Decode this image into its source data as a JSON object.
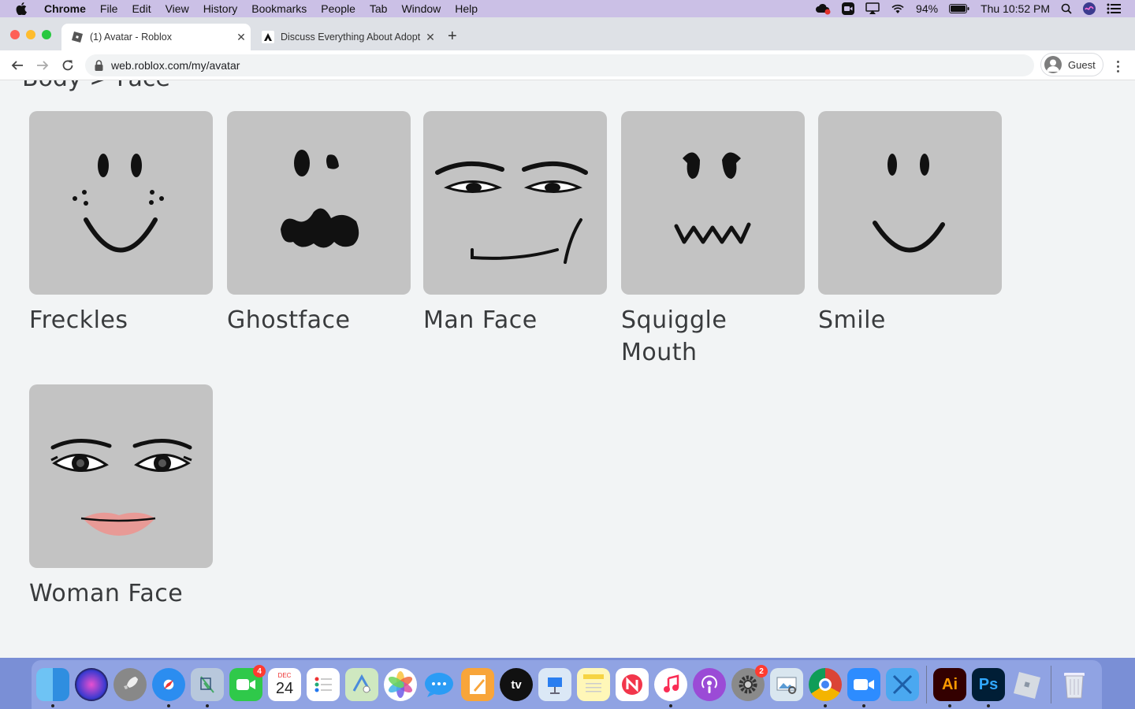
{
  "menubar": {
    "app": "Chrome",
    "items": [
      "File",
      "Edit",
      "View",
      "History",
      "Bookmarks",
      "People",
      "Tab",
      "Window",
      "Help"
    ],
    "battery": "94%",
    "clock": "Thu 10:52 PM"
  },
  "browser": {
    "tabs": [
      {
        "title": "(1) Avatar - Roblox",
        "active": true
      },
      {
        "title": "Discuss Everything About Adopt",
        "active": false
      }
    ],
    "url": "web.roblox.com/my/avatar",
    "profile": "Guest"
  },
  "page": {
    "breadcrumb": "Body > Face",
    "faces": [
      {
        "name": "Freckles",
        "icon": "freckles-face-icon"
      },
      {
        "name": "Ghostface",
        "icon": "ghostface-icon"
      },
      {
        "name": "Man Face",
        "icon": "man-face-icon"
      },
      {
        "name": "Squiggle Mouth",
        "icon": "squiggle-mouth-face-icon"
      },
      {
        "name": "Smile",
        "icon": "smile-face-icon"
      },
      {
        "name": "Woman Face",
        "icon": "woman-face-icon"
      }
    ]
  },
  "dock": {
    "apps": [
      "Finder",
      "Siri",
      "Launchpad",
      "Safari",
      "Mail",
      "FaceTime",
      "Calendar",
      "Reminders",
      "Maps",
      "Photos",
      "Messages",
      "Pages",
      "Apple TV",
      "Keynote",
      "Notes",
      "News",
      "Music",
      "Podcasts",
      "System Preferences",
      "Preview",
      "Chrome",
      "Zoom",
      "Xcode",
      "Illustrator",
      "Photoshop",
      "Roblox",
      "Trash"
    ],
    "calendar_month": "DEC",
    "calendar_day": "24",
    "facetime_badge": "4",
    "sysprefs_badge": "2",
    "illustrator_label": "Ai",
    "photoshop_label": "Ps",
    "appletv_label": "tv"
  }
}
